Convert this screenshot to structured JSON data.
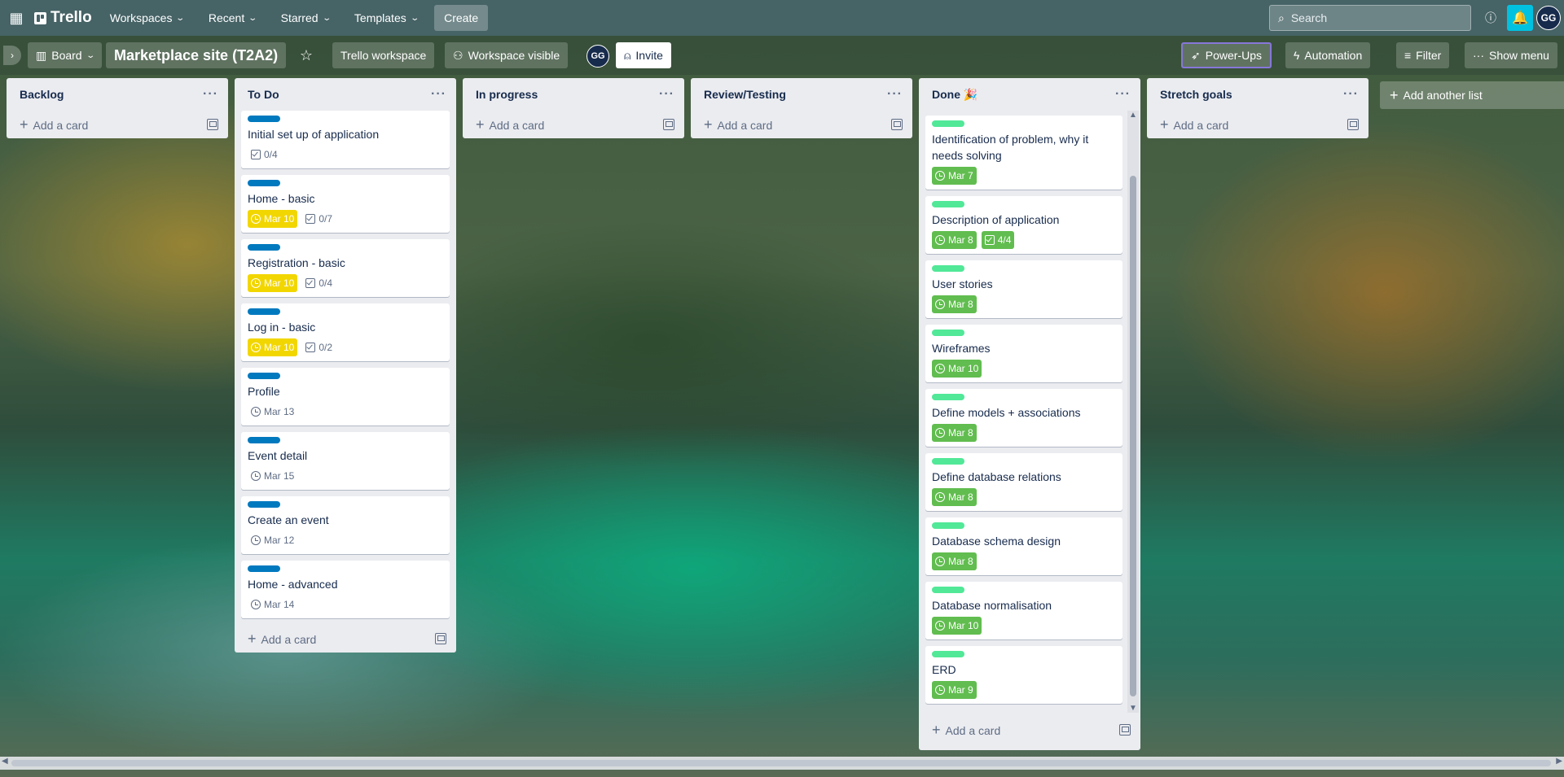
{
  "topbar": {
    "app_name": "Trello",
    "nav": [
      "Workspaces",
      "Recent",
      "Starred",
      "Templates"
    ],
    "create_label": "Create",
    "search_placeholder": "Search",
    "user_initials": "GG"
  },
  "board": {
    "view_label": "Board",
    "title": "Marketplace site (T2A2)",
    "workspace_label": "Trello workspace",
    "visibility_label": "Workspace visible",
    "member_initials": "GG",
    "invite_label": "Invite",
    "powerups_label": "Power-Ups",
    "automation_label": "Automation",
    "filter_label": "Filter",
    "show_menu_label": "Show menu",
    "add_list_label": "Add another list",
    "add_card_label": "Add a card"
  },
  "colors": {
    "label_blue": "#0079bf",
    "label_green": "#51e898",
    "due_yellow": "#f2d600",
    "due_green": "#61bd4f"
  },
  "lists": [
    {
      "title": "Backlog",
      "cards": []
    },
    {
      "title": "To Do",
      "cards": [
        {
          "title": "Initial set up of application",
          "label": "blue",
          "due": "",
          "checklist": "0/4"
        },
        {
          "title": "Home - basic",
          "label": "blue",
          "due": "Mar 10",
          "due_style": "yellow",
          "checklist": "0/7"
        },
        {
          "title": "Registration - basic",
          "label": "blue",
          "due": "Mar 10",
          "due_style": "yellow",
          "checklist": "0/4"
        },
        {
          "title": "Log in - basic",
          "label": "blue",
          "due": "Mar 10",
          "due_style": "yellow",
          "checklist": "0/2"
        },
        {
          "title": "Profile",
          "label": "blue",
          "due": "Mar 13",
          "due_style": "plain",
          "checklist": ""
        },
        {
          "title": "Event detail",
          "label": "blue",
          "due": "Mar 15",
          "due_style": "plain",
          "checklist": ""
        },
        {
          "title": "Create an event",
          "label": "blue",
          "due": "Mar 12",
          "due_style": "plain",
          "checklist": ""
        },
        {
          "title": "Home - advanced",
          "label": "blue",
          "due": "Mar 14",
          "due_style": "plain",
          "checklist": ""
        }
      ]
    },
    {
      "title": "In progress",
      "cards": []
    },
    {
      "title": "Review/Testing",
      "cards": []
    },
    {
      "title": "Done 🎉",
      "cards": [
        {
          "title": "Identification of problem, why it needs solving",
          "label": "green",
          "due": "Mar 7",
          "due_style": "green",
          "checklist": ""
        },
        {
          "title": "Description of application",
          "label": "green",
          "due": "Mar 8",
          "due_style": "green",
          "checklist": "4/4"
        },
        {
          "title": "User stories",
          "label": "green",
          "due": "Mar 8",
          "due_style": "green",
          "checklist": ""
        },
        {
          "title": "Wireframes",
          "label": "green",
          "due": "Mar 10",
          "due_style": "green",
          "checklist": ""
        },
        {
          "title": "Define models + associations",
          "label": "green",
          "due": "Mar 8",
          "due_style": "green",
          "checklist": ""
        },
        {
          "title": "Define database relations",
          "label": "green",
          "due": "Mar 8",
          "due_style": "green",
          "checklist": ""
        },
        {
          "title": "Database schema design",
          "label": "green",
          "due": "Mar 8",
          "due_style": "green",
          "checklist": ""
        },
        {
          "title": "Database normalisation",
          "label": "green",
          "due": "Mar 10",
          "due_style": "green",
          "checklist": ""
        },
        {
          "title": "ERD",
          "label": "green",
          "due": "Mar 9",
          "due_style": "green",
          "checklist": ""
        }
      ]
    },
    {
      "title": "Stretch goals",
      "cards": []
    }
  ]
}
